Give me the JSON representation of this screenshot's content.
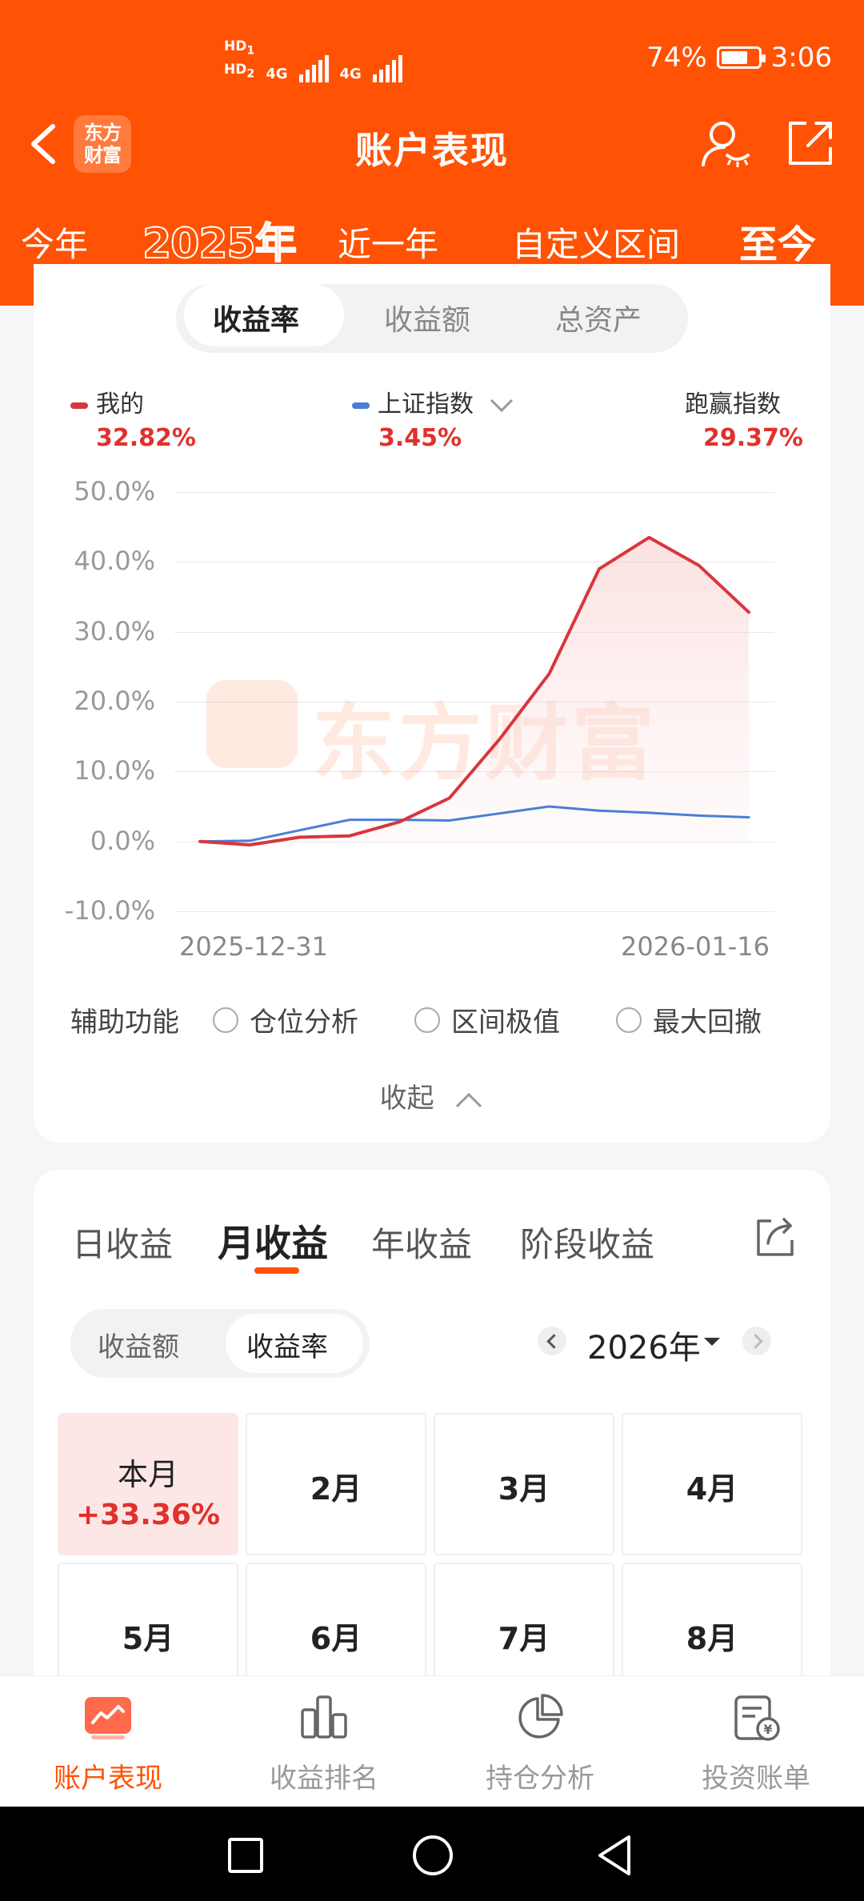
{
  "status_bar": {
    "hd1": "HD",
    "hd1_sim": "1",
    "hd2": "HD",
    "hd2_sim": "2",
    "net1": "4G",
    "net2": "4G",
    "battery": "74%",
    "time": "3:06"
  },
  "header": {
    "title": "账户表现",
    "logo_text": "东方财富"
  },
  "periods": [
    "今年",
    "2025年",
    "近一年",
    "自定义区间",
    "至今"
  ],
  "metric_tabs": [
    "收益率",
    "收益额",
    "总资产"
  ],
  "legend": [
    {
      "label": "我的",
      "value": "32.82%"
    },
    {
      "label": "上证指数",
      "value": "3.45%"
    },
    {
      "label": "跑赢指数",
      "value": "29.37%"
    }
  ],
  "chart_data": {
    "type": "line",
    "x_range": [
      "2025-12-31",
      "2026-01-16"
    ],
    "xtick_labels": [
      "2025-12-31",
      "2026-01-16"
    ],
    "ytick_labels": [
      "50.0%",
      "40.0%",
      "30.0%",
      "20.0%",
      "10.0%",
      "0.0%",
      "-10.0%"
    ],
    "ylim": [
      -10,
      50
    ],
    "grid": true,
    "watermark": "东方财富",
    "colors": {
      "mine": "#d9363e",
      "index": "#4a7fd6"
    },
    "series": [
      {
        "name": "我的",
        "values": [
          0.0,
          -0.5,
          0.6,
          0.8,
          2.8,
          6.2,
          14.6,
          24.0,
          39.0,
          43.5,
          39.5,
          32.8
        ]
      },
      {
        "name": "上证指数",
        "values": [
          0.0,
          0.1,
          1.6,
          3.1,
          3.1,
          3.0,
          4.0,
          5.0,
          4.4,
          4.1,
          3.7,
          3.45
        ]
      }
    ]
  },
  "aux": {
    "label": "辅助功能",
    "options": [
      "仓位分析",
      "区间极值",
      "最大回撤"
    ]
  },
  "collapse_label": "收起",
  "return_tabs": [
    "日收益",
    "月收益",
    "年收益",
    "阶段收益"
  ],
  "amount_toggle": [
    "收益额",
    "收益率"
  ],
  "year_selector": "2026年",
  "months": [
    {
      "label": "本月",
      "value": "+33.36%"
    },
    {
      "label": "2月"
    },
    {
      "label": "3月"
    },
    {
      "label": "4月"
    },
    {
      "label": "5月"
    },
    {
      "label": "6月"
    },
    {
      "label": "7月"
    },
    {
      "label": "8月"
    }
  ],
  "bottom_tabs": [
    "账户表现",
    "收益排名",
    "持仓分析",
    "投资账单"
  ]
}
